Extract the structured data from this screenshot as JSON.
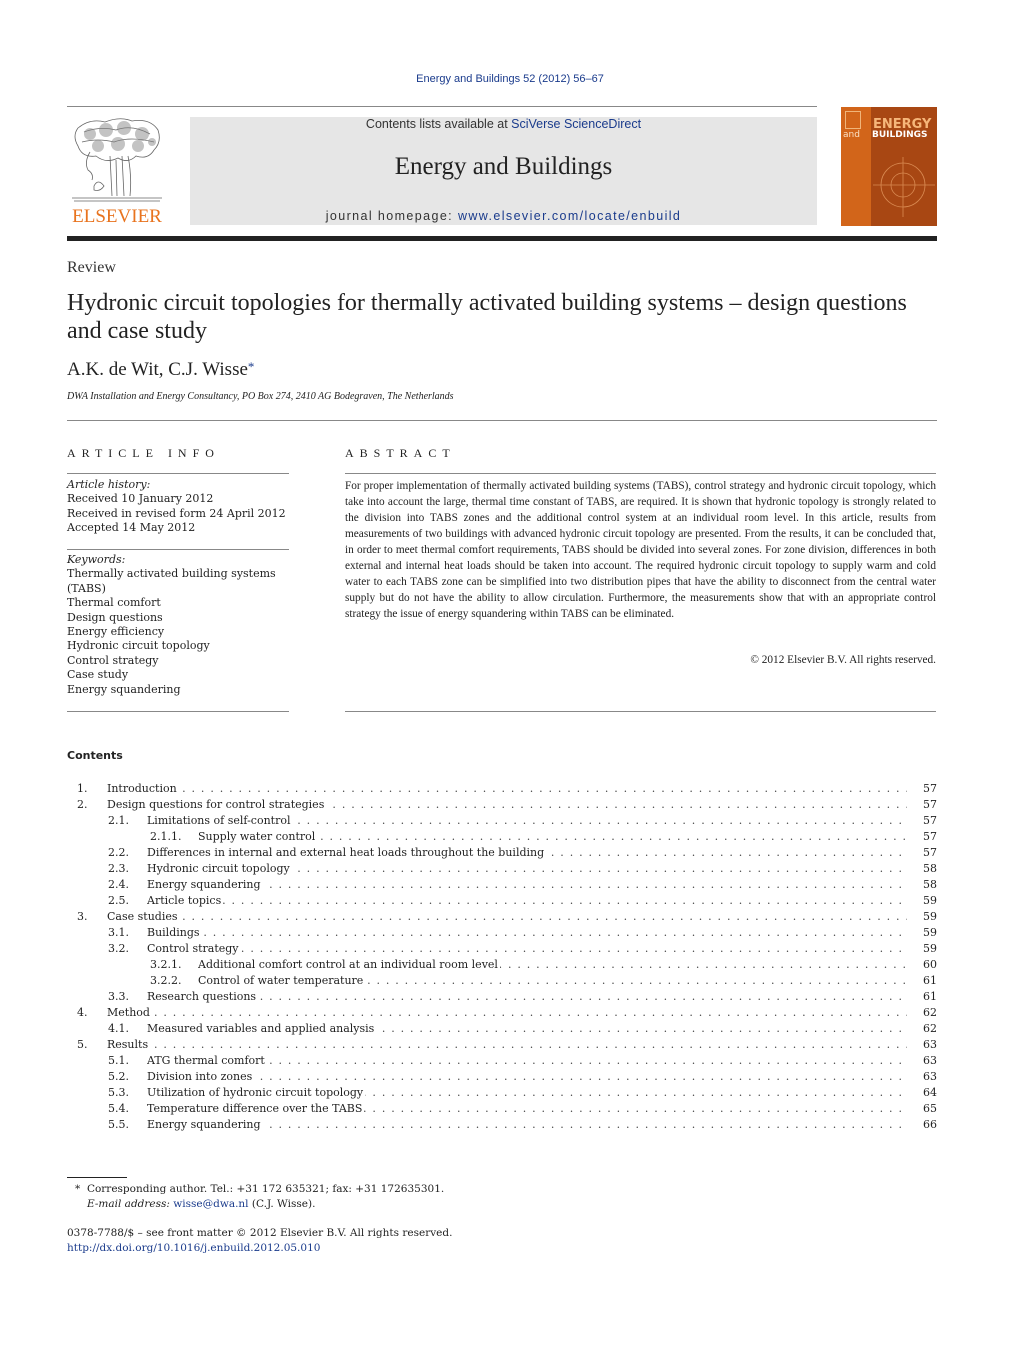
{
  "citation": "Energy and Buildings 52 (2012) 56–67",
  "header": {
    "publisher_logo_text": "ELSEVIER",
    "contents_prefix": "Contents lists available at ",
    "contents_link": "SciVerse ScienceDirect",
    "journal_name": "Energy and Buildings",
    "homepage_prefix": "journal homepage: ",
    "homepage_link": "www.elsevier.com/locate/enbuild",
    "cover": {
      "line1": "ENERGY",
      "line2a": "and",
      "line2b": "BUILDINGS",
      "colors": {
        "light": "#d2651a",
        "dark": "#a84713"
      }
    }
  },
  "article": {
    "type": "Review",
    "title": "Hydronic circuit topologies for thermally activated building systems – design questions and case study",
    "authors": "A.K. de Wit, C.J. Wisse",
    "author_mark": "*",
    "affiliation": "DWA Installation and Energy Consultancy, PO Box 274, 2410 AG Bodegraven, The Netherlands"
  },
  "article_info": {
    "heading": "ARTICLE INFO",
    "history_label": "Article history:",
    "history": [
      "Received 10 January 2012",
      "Received in revised form 24 April 2012",
      "Accepted 14 May 2012"
    ],
    "keywords_label": "Keywords:",
    "keywords": [
      "Thermally activated building systems (TABS)",
      "Thermal comfort",
      "Design questions",
      "Energy efficiency",
      "Hydronic circuit topology",
      "Control strategy",
      "Case study",
      "Energy squandering"
    ]
  },
  "abstract": {
    "heading": "ABSTRACT",
    "text": "For proper implementation of thermally activated building systems (TABS), control strategy and hydronic circuit topology, which take into account the large, thermal time constant of TABS, are required. It is shown that hydronic topology is strongly related to the division into TABS zones and the additional control system at an individual room level. In this article, results from measurements of two buildings with advanced hydronic circuit topology are presented. From the results, it can be concluded that, in order to meet thermal comfort requirements, TABS should be divided into several zones. For zone division, differences in both external and internal heat loads should be taken into account. The required hydronic circuit topology to supply warm and cold water to each TABS zone can be simplified into two distribution pipes that have the ability to disconnect from the central water supply but do not have the ability to allow circulation. Furthermore, the measurements show that with an appropriate control strategy the issue of energy squandering within TABS can be eliminated.",
    "copyright": "© 2012 Elsevier B.V. All rights reserved."
  },
  "contents": {
    "heading": "Contents",
    "entries": [
      {
        "num": "1.",
        "label": "Introduction",
        "page": "57",
        "level": 1
      },
      {
        "num": "2.",
        "label": "Design questions for control strategies",
        "page": "57",
        "level": 1
      },
      {
        "num": "2.1.",
        "label": "Limitations of self-control",
        "page": "57",
        "level": 2
      },
      {
        "num": "2.1.1.",
        "label": "Supply water control",
        "page": "57",
        "level": 3
      },
      {
        "num": "2.2.",
        "label": "Differences in internal and external heat loads throughout the building",
        "page": "57",
        "level": 2
      },
      {
        "num": "2.3.",
        "label": "Hydronic circuit topology",
        "page": "58",
        "level": 2
      },
      {
        "num": "2.4.",
        "label": "Energy squandering",
        "page": "58",
        "level": 2
      },
      {
        "num": "2.5.",
        "label": "Article topics",
        "page": "59",
        "level": 2
      },
      {
        "num": "3.",
        "label": "Case studies",
        "page": "59",
        "level": 1
      },
      {
        "num": "3.1.",
        "label": "Buildings",
        "page": "59",
        "level": 2
      },
      {
        "num": "3.2.",
        "label": "Control strategy",
        "page": "59",
        "level": 2
      },
      {
        "num": "3.2.1.",
        "label": "Additional comfort control at an individual room level",
        "page": "60",
        "level": 3
      },
      {
        "num": "3.2.2.",
        "label": "Control of water temperature",
        "page": "61",
        "level": 3
      },
      {
        "num": "3.3.",
        "label": "Research questions",
        "page": "61",
        "level": 2
      },
      {
        "num": "4.",
        "label": "Method",
        "page": "62",
        "level": 1
      },
      {
        "num": "4.1.",
        "label": "Measured variables and applied analysis",
        "page": "62",
        "level": 2
      },
      {
        "num": "5.",
        "label": "Results",
        "page": "63",
        "level": 1
      },
      {
        "num": "5.1.",
        "label": "ATG thermal comfort",
        "page": "63",
        "level": 2
      },
      {
        "num": "5.2.",
        "label": "Division into zones",
        "page": "63",
        "level": 2
      },
      {
        "num": "5.3.",
        "label": "Utilization of hydronic circuit topology",
        "page": "64",
        "level": 2
      },
      {
        "num": "5.4.",
        "label": "Temperature difference over the TABS",
        "page": "65",
        "level": 2
      },
      {
        "num": "5.5.",
        "label": "Energy squandering",
        "page": "66",
        "level": 2
      }
    ]
  },
  "footnote": {
    "mark": "*",
    "text": "Corresponding author. Tel.: +31 172 635321; fax: +31 172635301.",
    "email_label": "E-mail address:",
    "email": "wisse@dwa.nl",
    "email_suffix": " (C.J. Wisse)."
  },
  "front_matter": {
    "issn_line": "0378-7788/$ – see front matter © 2012 Elsevier B.V. All rights reserved.",
    "doi_link": "http://dx.doi.org/10.1016/j.enbuild.2012.05.010"
  }
}
